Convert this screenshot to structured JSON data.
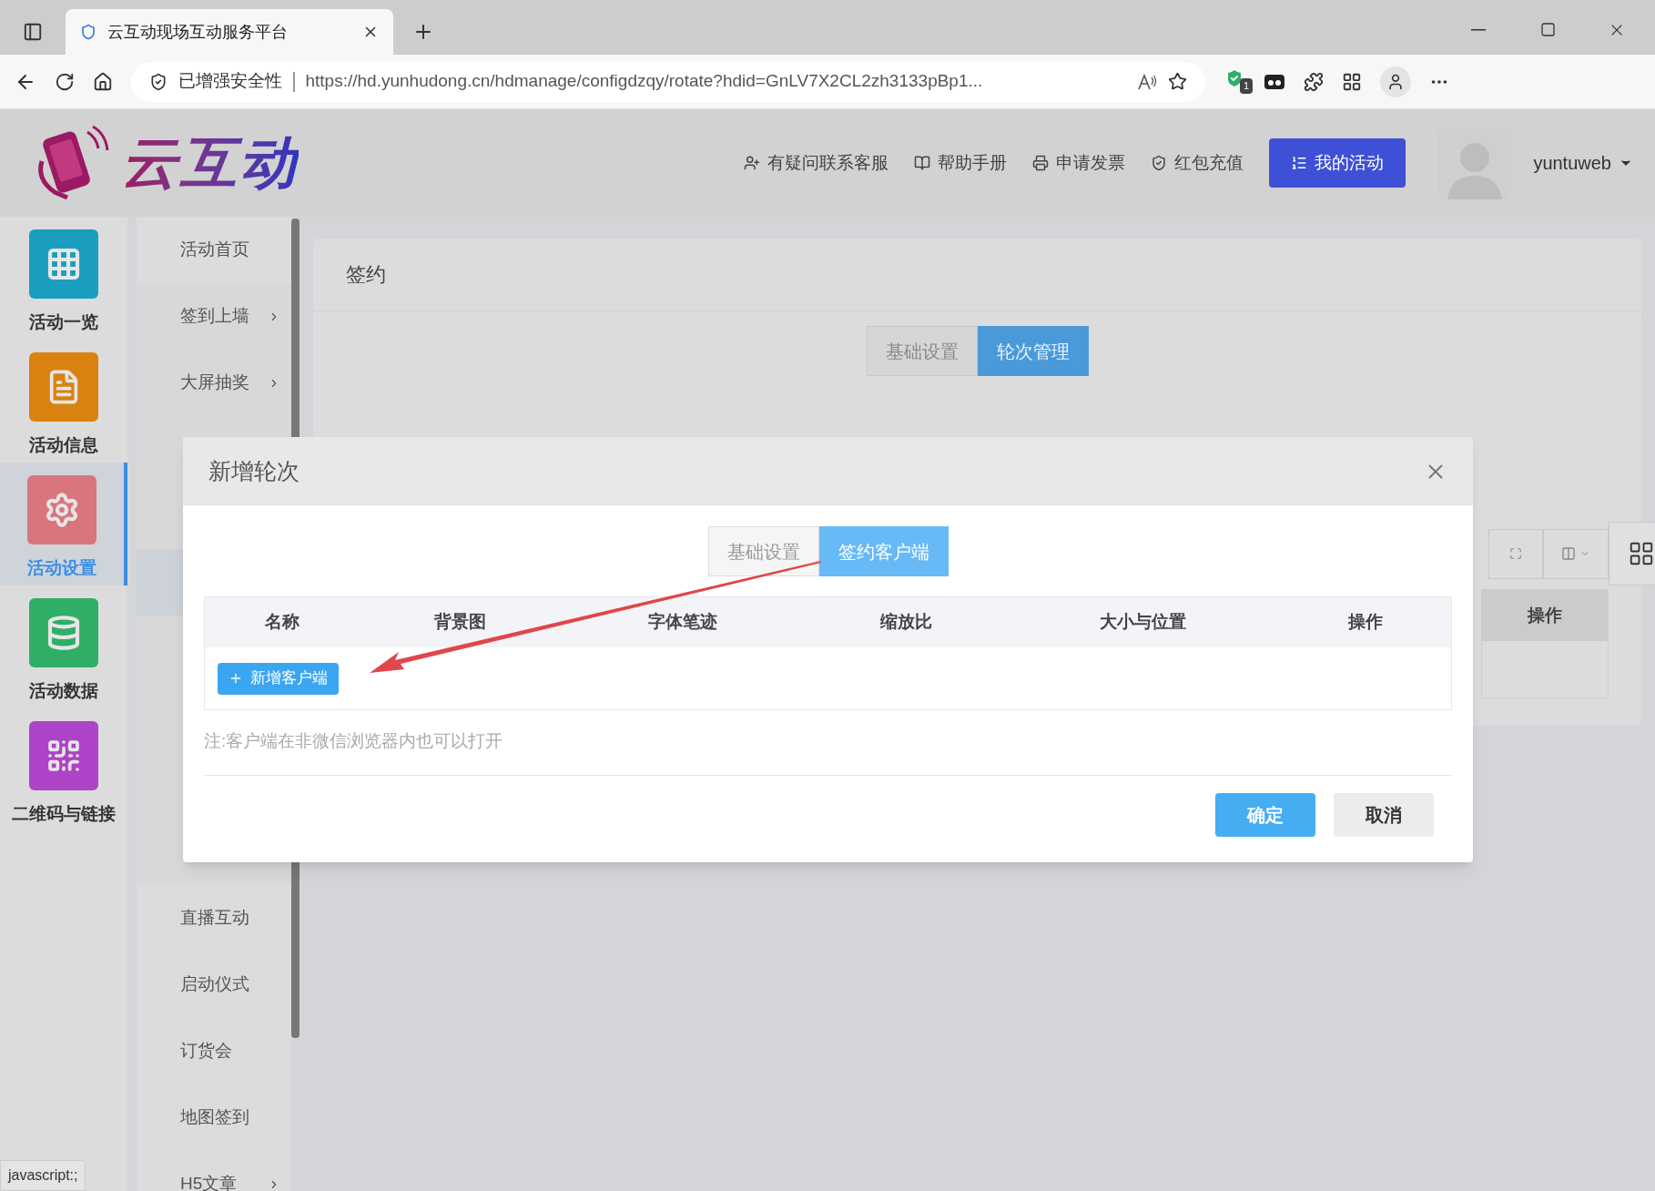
{
  "browser": {
    "tab_title": "云互动现场互动服务平台",
    "security": "已增强安全性",
    "url": "https://hd.yunhudong.cn/hdmanage/configdzqy/rotate?hdid=GnLV7X2CL2zh3133pBp1...",
    "extension_badge": "1"
  },
  "header": {
    "logo_text": "云互动",
    "links": [
      {
        "kind": "support",
        "label": "有疑问联系客服"
      },
      {
        "kind": "manual",
        "label": "帮助手册"
      },
      {
        "kind": "invoice",
        "label": "申请发票"
      },
      {
        "kind": "recharge",
        "label": "红包充值"
      }
    ],
    "my_activity": "我的活动",
    "username": "yuntuweb"
  },
  "sidebar": {
    "items": [
      {
        "kind": "grid",
        "label": "活动一览",
        "color": "#1a9ec0",
        "selected": false
      },
      {
        "kind": "doc",
        "label": "活动信息",
        "color": "#d9820f",
        "selected": false
      },
      {
        "kind": "gear",
        "label": "活动设置",
        "color": "#d9757c",
        "selected": true
      },
      {
        "kind": "db",
        "label": "活动数据",
        "color": "#2fae68",
        "selected": false
      },
      {
        "kind": "qr",
        "label": "二维码与链接",
        "color": "#ad43c6",
        "selected": false
      }
    ]
  },
  "submenu": {
    "top_items": [
      {
        "label": "活动首页",
        "has_children": false
      },
      {
        "label": "签到上墙",
        "has_children": true
      },
      {
        "label": "大屏抽奖",
        "has_children": true
      }
    ],
    "bottom_items": [
      {
        "label": "直播互动",
        "has_children": false
      },
      {
        "label": "启动仪式",
        "has_children": false
      },
      {
        "label": "订货会",
        "has_children": false
      },
      {
        "label": "地图签到",
        "has_children": false
      },
      {
        "label": "H5文章",
        "has_children": true
      }
    ]
  },
  "page": {
    "title": "签约",
    "tabs": [
      {
        "label": "基础设置",
        "selected": false
      },
      {
        "label": "轮次管理",
        "selected": true
      }
    ],
    "table_column": "操作"
  },
  "dialog": {
    "title": "新增轮次",
    "tabs": [
      {
        "label": "基础设置",
        "selected": false
      },
      {
        "label": "签约客户端",
        "selected": true
      }
    ],
    "columns": [
      "名称",
      "背景图",
      "字体笔迹",
      "缩放比",
      "大小与位置",
      "操作"
    ],
    "add_button": "新增客户端",
    "note": "注:客户端在非微信浏览器内也可以打开",
    "confirm": "确定",
    "cancel": "取消"
  },
  "status_bar": "javascript:;"
}
